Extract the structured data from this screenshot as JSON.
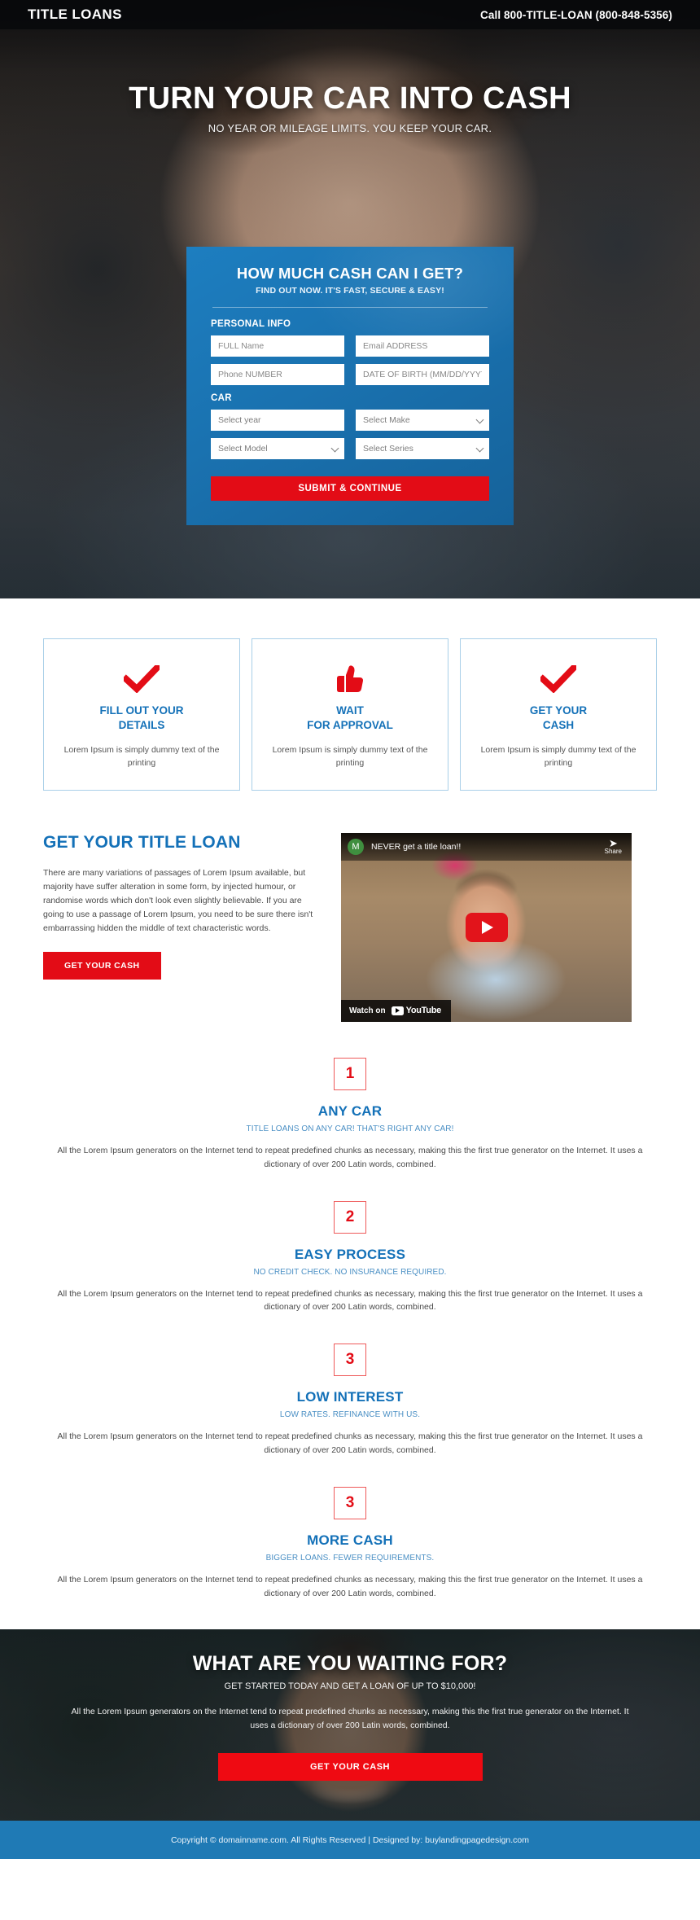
{
  "header": {
    "brand": "TITLE LOANS",
    "phone": "Call 800-TITLE-LOAN (800-848-5356)"
  },
  "hero": {
    "title": "TURN YOUR CAR INTO CASH",
    "subtitle": "NO YEAR OR MILEAGE LIMITS. YOU KEEP YOUR CAR."
  },
  "form": {
    "title": "HOW MUCH CASH CAN I GET?",
    "subtitle": "FIND OUT NOW. IT'S FAST, SECURE & EASY!",
    "legend_personal": "PERSONAL INFO",
    "legend_car": "CAR",
    "full_name_placeholder": "FULL Name",
    "email_placeholder": "Email ADDRESS",
    "phone_placeholder": "Phone NUMBER",
    "dob_placeholder": "DATE OF BIRTH (MM/DD/YYYY)",
    "year_placeholder": "Select year",
    "make_placeholder": "Select Make",
    "model_placeholder": "Select Model",
    "series_placeholder": "Select Series",
    "submit_label": "SUBMIT & CONTINUE",
    "accent_color": "#1a72b0",
    "button_color": "#e30c16"
  },
  "steps": [
    {
      "icon": "check-icon",
      "title": "FILL OUT YOUR\nDETAILS",
      "text": "Lorem Ipsum is simply dummy text of the printing"
    },
    {
      "icon": "thumbs-up-icon",
      "title": "WAIT\nFOR APPROVAL",
      "text": "Lorem Ipsum is simply dummy text of the printing"
    },
    {
      "icon": "check-icon",
      "title": "GET YOUR\nCASH",
      "text": "Lorem Ipsum is simply dummy text of the printing"
    }
  ],
  "loan_section": {
    "heading": "GET YOUR TITLE LOAN",
    "paragraph": "There are many variations of passages of Lorem Ipsum available, but majority have suffer alteration in some form, by injected humour, or randomise words which don't look even slightly believable. If you are going to use a passage of Lorem Ipsum, you need to be sure there isn't embarrassing hidden the middle of text characteristic words.",
    "button_label": "GET YOUR CASH"
  },
  "video": {
    "channel_initial": "M",
    "title": "NEVER get a title loan!!",
    "share_label": "Share",
    "watch_label": "Watch on",
    "platform": "YouTube"
  },
  "features": [
    {
      "number": "1",
      "title": "ANY CAR",
      "subtitle": "TITLE LOANS ON ANY CAR! THAT'S RIGHT ANY CAR!",
      "text": "All the Lorem Ipsum generators on the Internet tend to repeat predefined chunks as necessary, making this the first true generator on the Internet. It uses a dictionary of over 200 Latin words, combined."
    },
    {
      "number": "2",
      "title": "EASY PROCESS",
      "subtitle": "NO CREDIT CHECK. NO INSURANCE REQUIRED.",
      "text": "All the Lorem Ipsum generators on the Internet tend to repeat predefined chunks as necessary, making this the first true generator on the Internet. It uses a dictionary of over 200 Latin words, combined."
    },
    {
      "number": "3",
      "title": "LOW INTEREST",
      "subtitle": "LOW RATES. REFINANCE WITH US.",
      "text": "All the Lorem Ipsum generators on the Internet tend to repeat predefined chunks as necessary, making this the first true generator on the Internet. It uses a dictionary of over 200 Latin words, combined."
    },
    {
      "number": "3",
      "title": "MORE CASH",
      "subtitle": "BIGGER LOANS. FEWER REQUIREMENTS.",
      "text": "All the Lorem Ipsum generators on the Internet tend to repeat predefined chunks as necessary, making this the first true generator on the Internet. It uses a dictionary of over 200 Latin words, combined."
    }
  ],
  "cta": {
    "title": "WHAT ARE YOU WAITING FOR?",
    "subtitle": "GET STARTED TODAY AND GET A LOAN OF UP TO $10,000!",
    "text": "All the Lorem Ipsum generators on the Internet tend to repeat predefined chunks as necessary, making this the first true generator on the Internet. It uses a dictionary of over 200 Latin words, combined.",
    "button_label": "GET YOUR CASH"
  },
  "footer": {
    "text": "Copyright © domainname.com. All Rights Reserved | Designed by: buylandingpagedesign.com",
    "background_color": "#1f7ab5"
  }
}
